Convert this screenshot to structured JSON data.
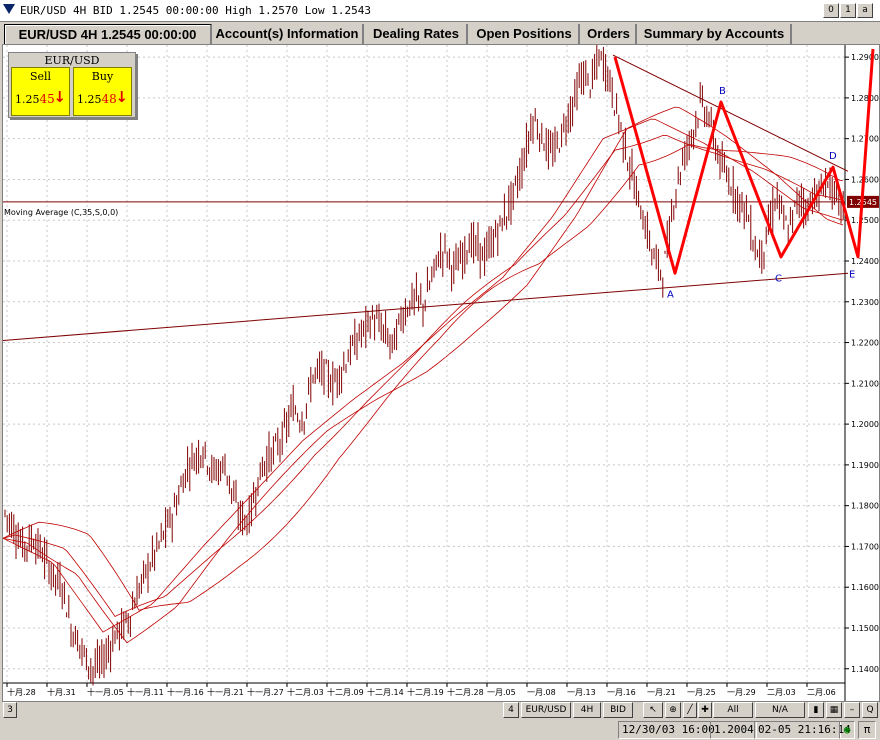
{
  "window": {
    "title": "EUR/USD 4H BID 1.2545 00:00:00 High 1.2570 Low 1.2543",
    "buttons": [
      "0",
      "1",
      "a"
    ]
  },
  "tabs": [
    {
      "label": "EUR/USD 4H 1.2545 00:00:00",
      "active": true
    },
    {
      "label": "Account(s) Information"
    },
    {
      "label": "Dealing Rates"
    },
    {
      "label": "Open Positions"
    },
    {
      "label": "Orders"
    },
    {
      "label": "Summary by Accounts"
    }
  ],
  "quote": {
    "symbol": "EUR/USD",
    "sell_label": "Sell",
    "buy_label": "Buy",
    "sell_prefix": "1.25",
    "sell_big": "45",
    "buy_prefix": "1.25",
    "buy_big": "48",
    "arrow": "↓"
  },
  "indicator_label": "Moving Average (C,35,S,0,0)",
  "chart_data": {
    "type": "line",
    "subtype": "candlestick-ohlc",
    "price_axis": {
      "ticks": [
        "1.2900",
        "1.2800",
        "1.2700",
        "1.2600",
        "1.2500",
        "1.2400",
        "1.2300",
        "1.2200",
        "1.2100",
        "1.2000",
        "1.1900",
        "1.1800",
        "1.1700",
        "1.1600",
        "1.1500",
        "1.1400"
      ],
      "current_price": "1.2545",
      "range": [
        1.137,
        1.2915
      ]
    },
    "time_axis": {
      "ticks": [
        "十月.28",
        "十月.31",
        "十一月.05",
        "十一月.11",
        "十一月.16",
        "十一月.21",
        "十一月.27",
        "十二月.03",
        "十二月.09",
        "十二月.14",
        "十二月.19",
        "十二月.28",
        "一月.05",
        "一月.08",
        "一月.13",
        "一月.16",
        "一月.21",
        "一月.25",
        "一月.29",
        "二月.03",
        "二月.06"
      ]
    },
    "series": [
      {
        "kind": "price",
        "x": [
          0,
          10,
          20,
          30,
          40,
          50,
          60,
          68,
          75,
          82,
          90,
          100,
          112,
          125,
          140,
          155,
          170,
          185,
          200,
          210,
          222,
          235,
          245,
          255,
          262,
          270,
          280,
          290,
          300,
          310,
          320,
          330,
          340,
          350,
          360,
          370,
          380,
          390,
          398,
          405,
          412,
          420,
          428,
          435,
          442,
          450,
          458,
          466,
          474,
          482,
          490,
          500,
          510,
          520,
          530,
          540,
          548,
          556,
          564,
          572,
          580,
          588,
          596,
          604,
          612,
          616,
          622,
          628,
          636,
          644,
          652,
          660,
          666,
          672,
          678,
          684,
          690,
          698,
          706,
          714,
          720,
          726,
          732,
          738,
          744,
          750,
          756,
          762,
          768,
          774,
          780,
          786,
          792,
          798,
          804,
          810,
          816,
          822,
          828,
          834,
          840
        ],
        "y": [
          1.179,
          1.175,
          1.17,
          1.172,
          1.168,
          1.163,
          1.16,
          1.15,
          1.147,
          1.143,
          1.14,
          1.142,
          1.148,
          1.152,
          1.162,
          1.17,
          1.178,
          1.19,
          1.194,
          1.188,
          1.19,
          1.178,
          1.176,
          1.186,
          1.191,
          1.193,
          1.197,
          1.204,
          1.201,
          1.212,
          1.213,
          1.21,
          1.214,
          1.219,
          1.223,
          1.226,
          1.223,
          1.219,
          1.226,
          1.229,
          1.231,
          1.229,
          1.235,
          1.241,
          1.243,
          1.238,
          1.24,
          1.245,
          1.243,
          1.241,
          1.245,
          1.25,
          1.256,
          1.264,
          1.275,
          1.27,
          1.266,
          1.269,
          1.275,
          1.28,
          1.286,
          1.283,
          1.29,
          1.287,
          1.278,
          1.275,
          1.268,
          1.262,
          1.254,
          1.247,
          1.24,
          1.237,
          1.246,
          1.257,
          1.263,
          1.268,
          1.272,
          1.279,
          1.275,
          1.267,
          1.262,
          1.26,
          1.257,
          1.254,
          1.252,
          1.245,
          1.241,
          1.244,
          1.251,
          1.256,
          1.25,
          1.247,
          1.253,
          1.256,
          1.252,
          1.257,
          1.255,
          1.26,
          1.258,
          1.254,
          1.254
        ]
      },
      {
        "kind": "moving-average",
        "name": "Moving Average (C,35,S,0,0)",
        "x": [
          0,
          50,
          100,
          150,
          200,
          250,
          300,
          350,
          400,
          450,
          500,
          550,
          600,
          650,
          700,
          750,
          800,
          840
        ],
        "y": [
          1.172,
          1.166,
          1.149,
          1.156,
          1.17,
          1.183,
          1.196,
          1.206,
          1.215,
          1.226,
          1.236,
          1.251,
          1.27,
          1.275,
          1.269,
          1.262,
          1.253,
          1.25
        ]
      }
    ],
    "pattern": {
      "labels": [
        "A",
        "B",
        "C",
        "D",
        "E"
      ],
      "points": [
        [
          612,
          1.29
        ],
        [
          672,
          1.237
        ],
        [
          718,
          1.279
        ],
        [
          778,
          1.241
        ],
        [
          830,
          1.263
        ],
        [
          855,
          1.241
        ],
        [
          870,
          1.292
        ]
      ]
    },
    "trendlines": [
      {
        "from": [
          0,
          1.2205
        ],
        "to": [
          845,
          1.237
        ]
      },
      {
        "from": [
          610,
          1.2905
        ],
        "to": [
          845,
          1.262
        ]
      }
    ],
    "colors": {
      "candle": "#800000",
      "ma": "#c00000",
      "pattern": "#ff0000",
      "trend": "#800000",
      "grid": "#c8c8c8"
    }
  },
  "bottom_bar": {
    "left": "3",
    "buttons": [
      "4",
      "EUR/USD",
      "4H",
      "BID",
      "All",
      "N/A"
    ]
  },
  "status": {
    "date": "12/30/03 16:00",
    "price": "1.2004",
    "time": "02-05 21:16:14"
  }
}
